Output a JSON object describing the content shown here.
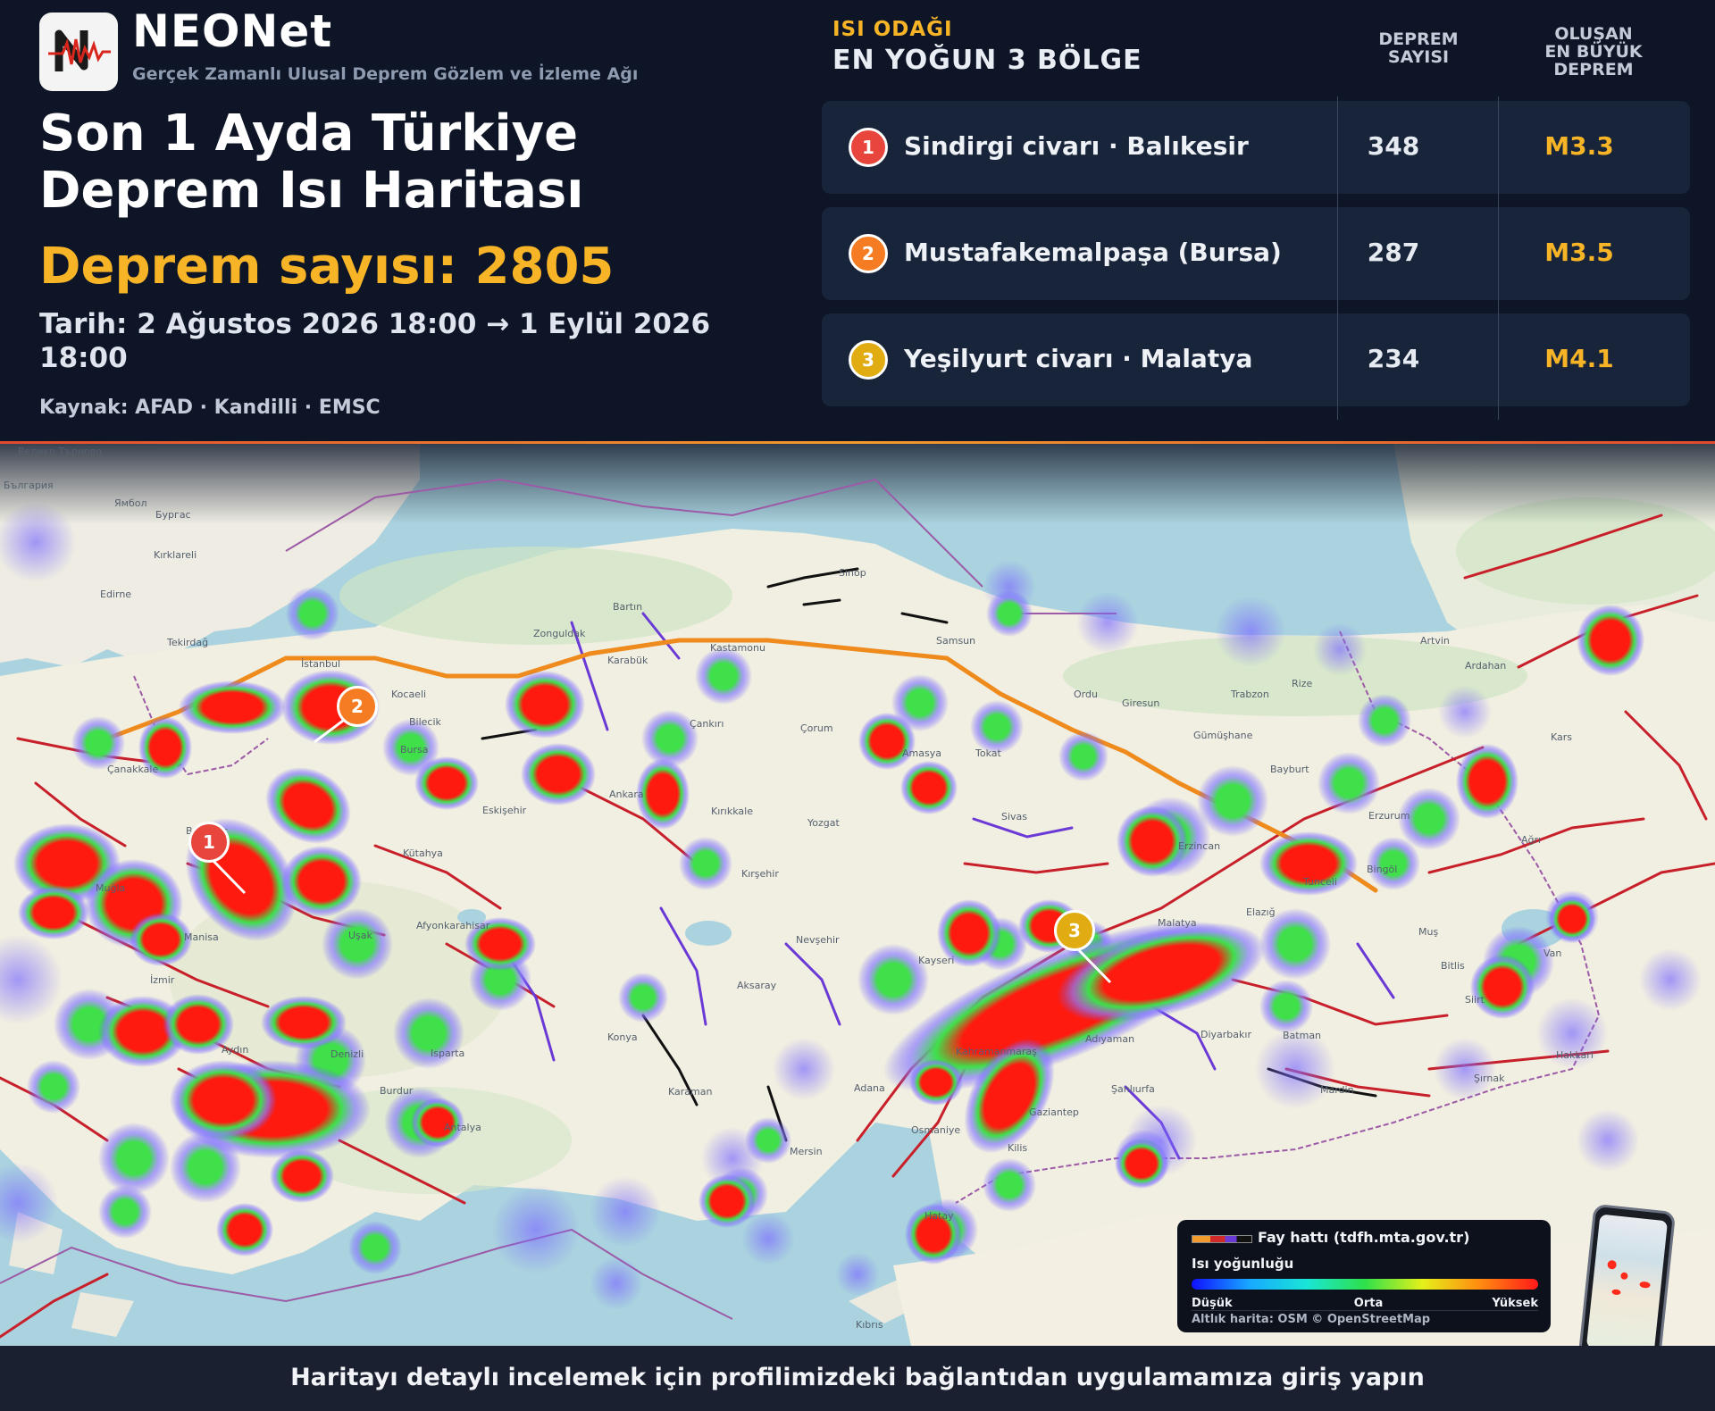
{
  "brand": {
    "name": "NEONet",
    "tagline": "Gerçek Zamanlı Ulusal Deprem Gözlem ve İzleme Ağı"
  },
  "headline": {
    "title_line1": "Son 1 Ayda Türkiye",
    "title_line2": "Deprem Isı Haritası",
    "count_text": "Deprem sayısı: 2805",
    "date_text": "Tarih: 2 Ağustos 2026 18:00 → 1 Eylül 2026 18:00",
    "source_text": "Kaynak: AFAD · Kandilli · EMSC"
  },
  "hotspots": {
    "kicker": "ISI ODAĞI",
    "title": "EN YOĞUN 3 BÖLGE",
    "col_count": [
      "DEPREM",
      "SAYISI"
    ],
    "col_max": [
      "OLUŞAN",
      "EN BÜYÜK",
      "DEPREM"
    ],
    "rows": [
      {
        "rank": "1",
        "region": "Sindirgi civarı · Balıkesir",
        "count": "348",
        "max": "M3.3",
        "color": "#e8453c"
      },
      {
        "rank": "2",
        "region": "Mustafakemalpaşa (Bursa)",
        "count": "287",
        "max": "M3.5",
        "color": "#f57c22"
      },
      {
        "rank": "3",
        "region": "Yeşilyurt civarı · Malatya",
        "count": "234",
        "max": "M4.1",
        "color": "#e0ac12"
      }
    ]
  },
  "map": {
    "markers": [
      {
        "rank": "1",
        "color": "#e8453c"
      },
      {
        "rank": "2",
        "color": "#f57c22"
      },
      {
        "rank": "3",
        "color": "#e0ac12"
      }
    ],
    "place_labels": [
      "Велико Търново",
      "България",
      "Бургас",
      "Ямбол",
      "Kırklareli",
      "Edirne",
      "Tekirdağ",
      "Çanakkale",
      "Balıkesir",
      "Manisa",
      "İzmir",
      "Aydın",
      "Muğla",
      "Denizli",
      "Uşak",
      "Kütahya",
      "Bilecik",
      "Eskişehir",
      "Bursa",
      "Kocaeli",
      "İstanbul",
      "Zonguldak",
      "Bartın",
      "Karabük",
      "Kastamonu",
      "Sinop",
      "Samsun",
      "Amasya",
      "Çorum",
      "Çankırı",
      "Ankara",
      "Kırıkkale",
      "Yozgat",
      "Kırşehir",
      "Nevşehir",
      "Aksaray",
      "Konya",
      "Karaman",
      "Mersin",
      "Adana",
      "Osmaniye",
      "Kahramanmaraş",
      "Kayseri",
      "Sivas",
      "Tokat",
      "Ordu",
      "Giresun",
      "Trabzon",
      "Rize",
      "Gümüşhane",
      "Bayburt",
      "Erzincan",
      "Erzurum",
      "Ağrı",
      "Van",
      "Bitlis",
      "Muş",
      "Diyarbakır",
      "Batman",
      "Şanlıurfa",
      "Adıyaman",
      "Mardin",
      "Şırnak",
      "Hakkari",
      "Kilis",
      "Isparta",
      "Burdur",
      "Antalya",
      "Afyonkarahisar",
      "Kıbrıs",
      "Kars",
      "Ardahan",
      "Artvin",
      "Elazığ",
      "Malatya",
      "Hatay",
      "Gaziantep",
      "Tunceli",
      "Bingöl",
      "Siirt"
    ],
    "legend": {
      "fault_title": "Fay hattı (tdfh.mta.gov.tr)",
      "heat_title": "Isı yoğunluğu",
      "low": "Düşük",
      "mid": "Orta",
      "high": "Yüksek",
      "attribution": "Altlık harita: OSM © OpenStreetMap"
    }
  },
  "footer": {
    "text": "Haritayı detaylı incelemek için profilimizdeki bağlantıdan uygulamamıza giriş yapın"
  }
}
